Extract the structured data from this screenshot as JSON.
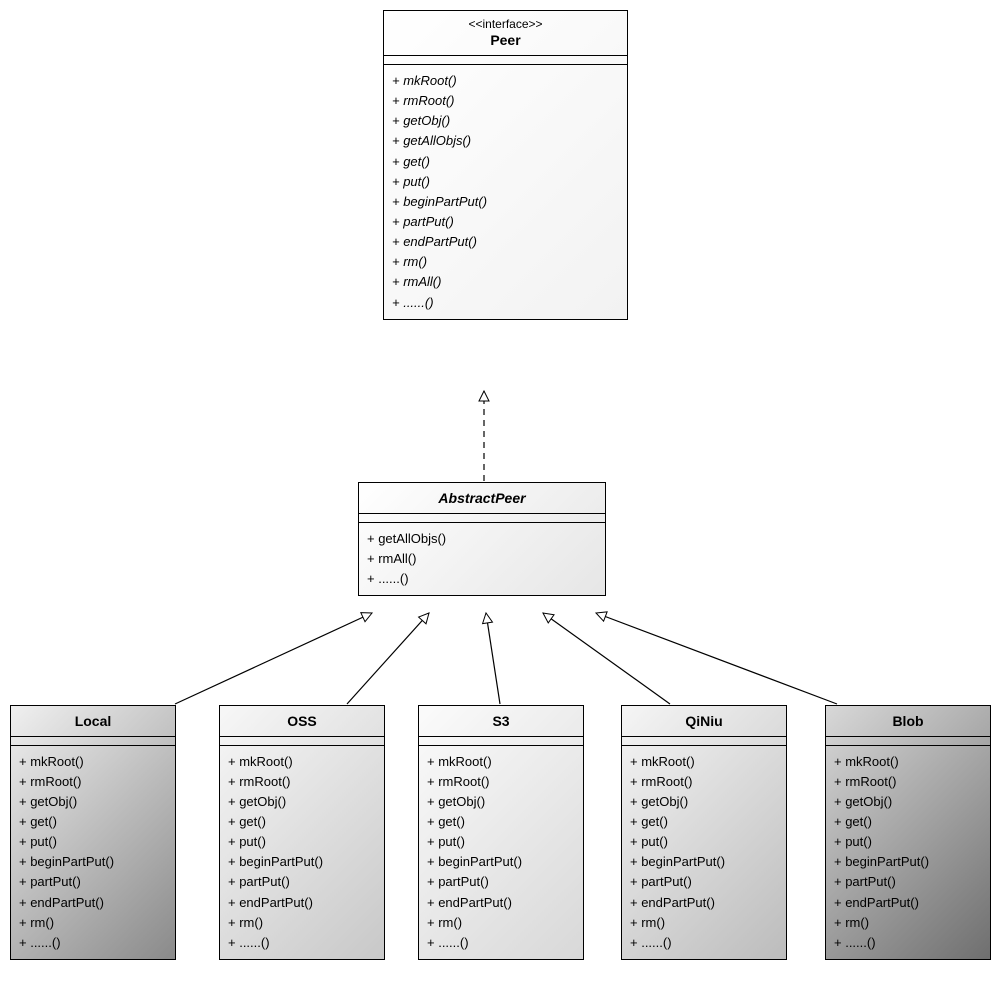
{
  "interface": {
    "stereotype": "<<interface>>",
    "name": "Peer",
    "methods": [
      "+ mkRoot()",
      "+ rmRoot()",
      "+ getObj()",
      "+ getAllObjs()",
      "+ get()",
      "+ put()",
      "+ beginPartPut()",
      "+ partPut()",
      "+ endPartPut()",
      "+ rm()",
      "+ rmAll()",
      "+ ......()"
    ],
    "methods_italic": [
      true,
      true,
      true,
      true,
      true,
      true,
      true,
      true,
      true,
      true,
      true,
      true
    ]
  },
  "abstract": {
    "name": "AbstractPeer",
    "methods": [
      "+ getAllObjs()",
      "+ rmAll()",
      "+ ......()"
    ]
  },
  "subclasses": [
    {
      "name": "Local",
      "grad": "grad-local"
    },
    {
      "name": "OSS",
      "grad": "grad-oss"
    },
    {
      "name": "S3",
      "grad": "grad-s3"
    },
    {
      "name": "QiNiu",
      "grad": "grad-qiniu"
    },
    {
      "name": "Blob",
      "grad": "grad-blob"
    }
  ],
  "subclass_methods": [
    "+ mkRoot()",
    "+ rmRoot()",
    "+ getObj()",
    "+ get()",
    "+ put()",
    "+ beginPartPut()",
    "+ partPut()",
    "+ endPartPut()",
    "+ rm()",
    "+ ......()"
  ]
}
